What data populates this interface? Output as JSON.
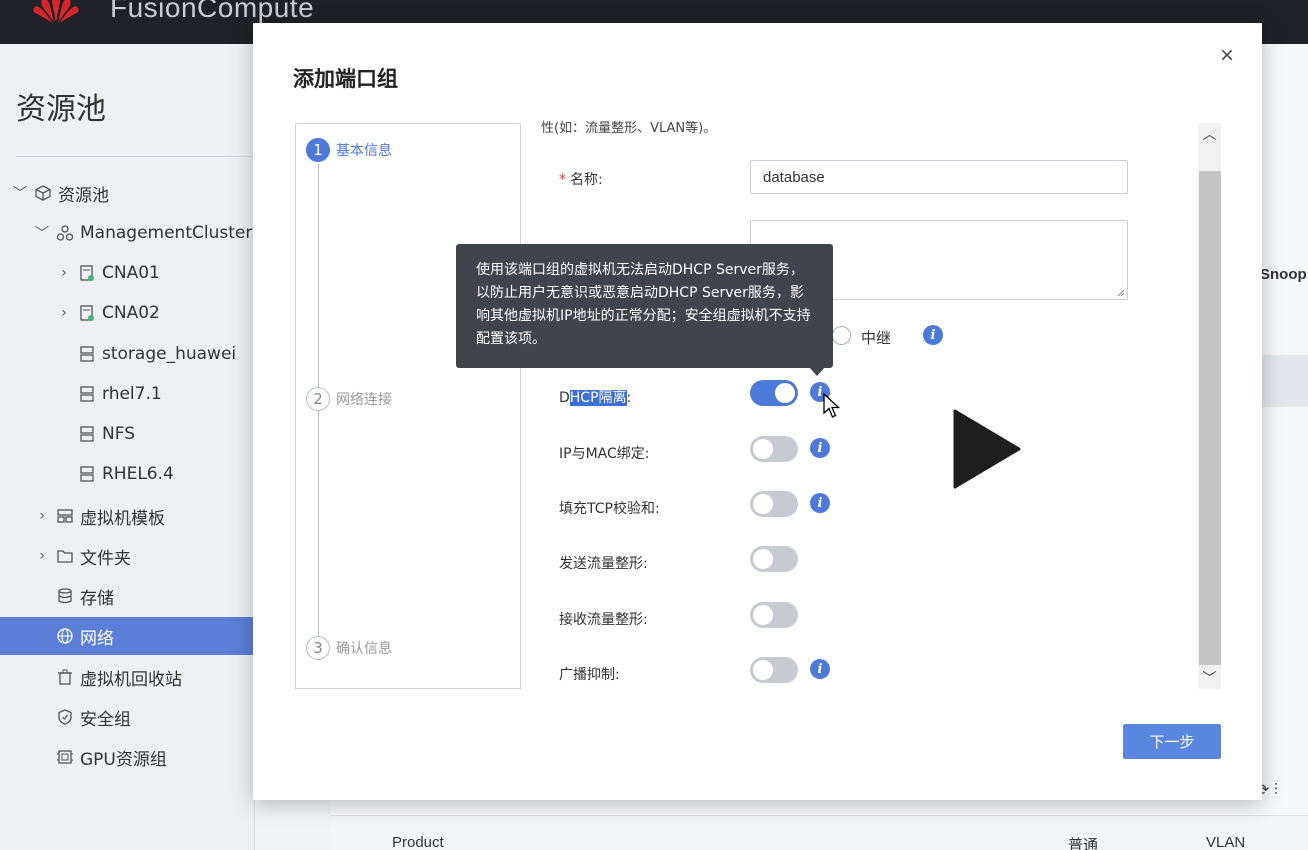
{
  "app": {
    "brand": "FusionCompute"
  },
  "sidebar": {
    "title": "资源池",
    "items": [
      {
        "label": "资源池",
        "chevron": "﹀",
        "icon": "cube-icon"
      },
      {
        "label": "ManagementCluster",
        "chevron": "﹀",
        "icon": "cluster-icon"
      },
      {
        "label": "CNA01",
        "chevron": "›",
        "icon": "host-icon"
      },
      {
        "label": "CNA02",
        "chevron": "›",
        "icon": "host-icon"
      },
      {
        "label": "storage_huawei",
        "chevron": "",
        "icon": "datastore-icon"
      },
      {
        "label": "rhel7.1",
        "chevron": "",
        "icon": "datastore-icon"
      },
      {
        "label": "NFS",
        "chevron": "",
        "icon": "datastore-icon"
      },
      {
        "label": "RHEL6.4",
        "chevron": "",
        "icon": "datastore-icon"
      },
      {
        "label": "虚拟机模板",
        "chevron": "›",
        "icon": "template-icon"
      },
      {
        "label": "文件夹",
        "chevron": "›",
        "icon": "folder-icon"
      },
      {
        "label": "存储",
        "chevron": "",
        "icon": "storage-icon"
      },
      {
        "label": "网络",
        "chevron": "",
        "icon": "globe-icon"
      },
      {
        "label": "虚拟机回收站",
        "chevron": "",
        "icon": "recycle-icon"
      },
      {
        "label": "安全组",
        "chevron": "",
        "icon": "shield-icon"
      },
      {
        "label": "GPU资源组",
        "chevron": "",
        "icon": "gpu-icon"
      }
    ]
  },
  "background": {
    "snoop": "Snoop",
    "product": "Product",
    "putong": "普通",
    "vlan": "VLAN"
  },
  "modal": {
    "title": "添加端口组",
    "close": "×",
    "steps": [
      {
        "num": "1",
        "label": "基本信息"
      },
      {
        "num": "2",
        "label": "网络连接"
      },
      {
        "num": "3",
        "label": "确认信息"
      }
    ],
    "intro_text": "性(如：流量整形、VLAN等)。",
    "name_label": "名称:",
    "name_required": "*",
    "name_value": "database",
    "radio_label": "中继",
    "dhcp_label_pre": "D",
    "dhcp_label_sel": "HCP隔离",
    "dhcp_label_post": ":",
    "ipmac_label": "IP与MAC绑定:",
    "tcp_label": "填充TCP校验和:",
    "send_label": "发送流量整形:",
    "recv_label": "接收流量整形:",
    "bcast_label": "广播抑制:",
    "next_button": "下一步",
    "info_glyph": "i",
    "tooltip": "使用该端口组的虚拟机无法启动DHCP Server服务，以防止用户无意识或恶意启动DHCP Server服务，影响其他虚拟机IP地址的正常分配；安全组虚拟机不支持配置该项。",
    "toggles": {
      "dhcp": true,
      "ipmac": false,
      "tcp": false,
      "send": false,
      "recv": false,
      "bcast": false
    }
  },
  "colors": {
    "accent": "#4d79d9",
    "sidebar_active": "#5b7fd6",
    "tooltip_bg": "#3f444d"
  }
}
